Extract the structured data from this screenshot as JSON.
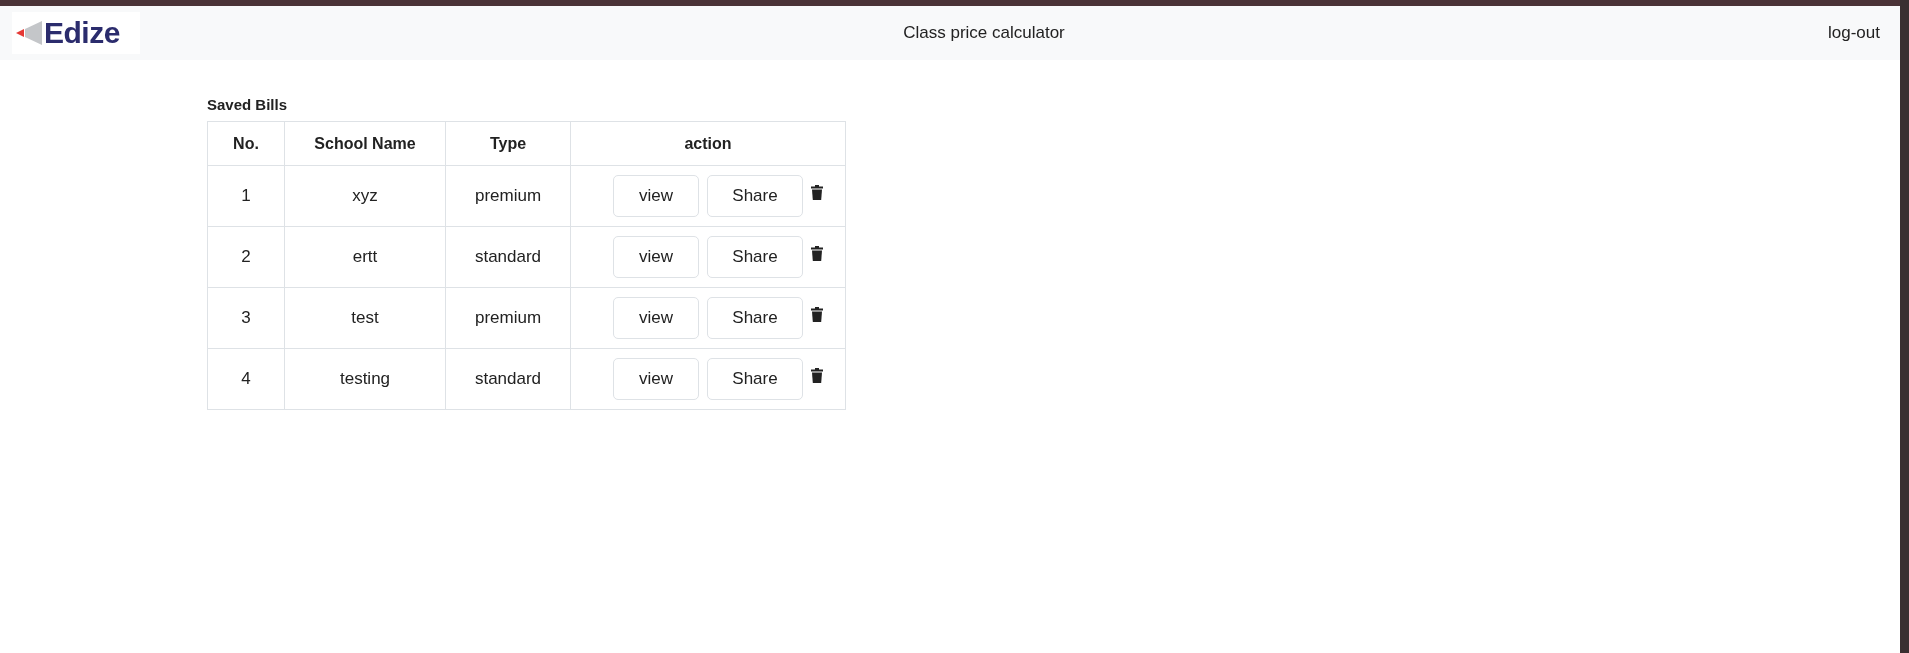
{
  "header": {
    "logo": "Edize",
    "title": "Class price calculator",
    "logout": "log-out"
  },
  "saved_bills": {
    "title": "Saved Bills",
    "columns": [
      "No.",
      "School Name",
      "Type",
      "action"
    ],
    "rows": [
      {
        "no": "1",
        "school": "xyz",
        "type": "premium",
        "view": "view",
        "share": "Share"
      },
      {
        "no": "2",
        "school": "ertt",
        "type": "standard",
        "view": "view",
        "share": "Share"
      },
      {
        "no": "3",
        "school": "test",
        "type": "premium",
        "view": "view",
        "share": "Share"
      },
      {
        "no": "4",
        "school": "testing",
        "type": "standard",
        "view": "view",
        "share": "Share"
      }
    ]
  }
}
